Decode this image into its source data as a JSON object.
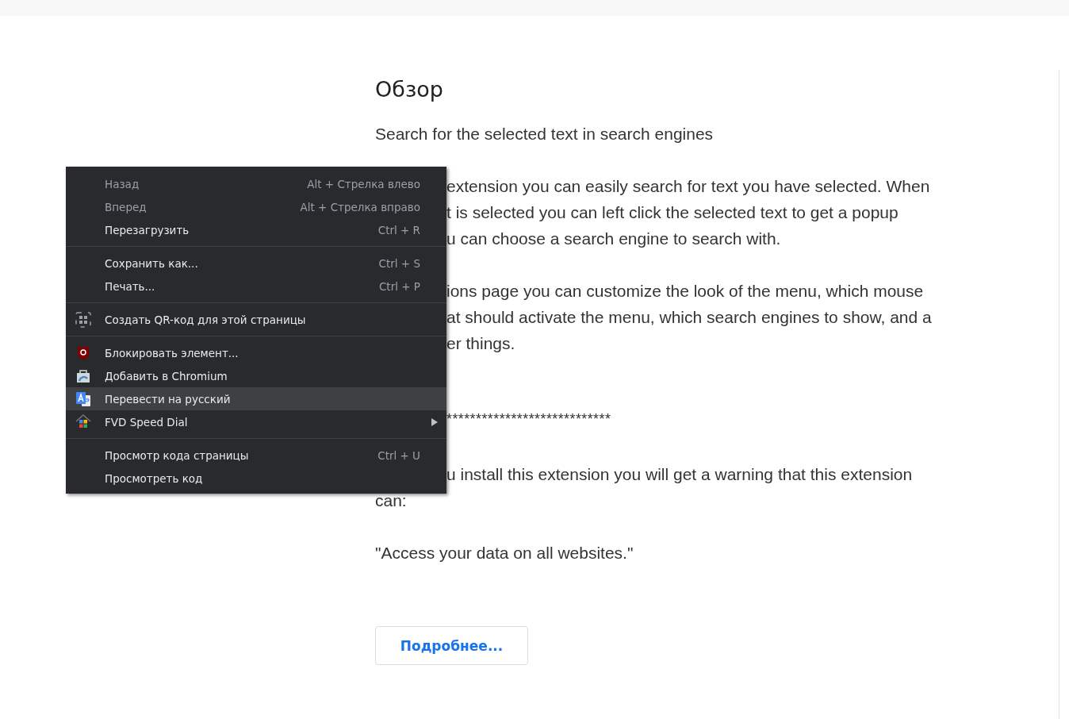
{
  "page": {
    "heading": "Обзор",
    "subtitle": "Search for the selected text in search engines",
    "paragraphs": [
      {
        "kind": "text",
        "lines": [
          {
            "text": "extension you can easily search for text you have selected. When",
            "clipped": true
          },
          {
            "text": "t is selected you can left click the selected text to get a popup",
            "clipped": true
          },
          {
            "text": "u can choose  a search engine to search with.",
            "clipped": true
          }
        ]
      },
      {
        "kind": "text",
        "lines": [
          {
            "text": "ions page you can customize the look of the menu, which mouse",
            "clipped": true
          },
          {
            "text": "at should activate the menu, which search engines to show, and a",
            "clipped": true
          },
          {
            "text": "er things.",
            "clipped": true
          }
        ]
      },
      {
        "kind": "divider",
        "lines": [
          {
            "text": "****************************",
            "clipped": true
          }
        ]
      },
      {
        "kind": "text",
        "lines": [
          {
            "text": "u install this extension you will get a warning that this extension",
            "clipped": true
          },
          {
            "text": "can:"
          }
        ]
      },
      {
        "kind": "text",
        "lines": [
          {
            "text": "\"Access your data on all websites.\""
          }
        ]
      }
    ],
    "more_button": "Подробнее..."
  },
  "context_menu": {
    "groups": [
      [
        {
          "kind": "plain",
          "label": "Назад",
          "shortcut": "Alt + Стрелка влево",
          "disabled": true,
          "selected": false
        },
        {
          "kind": "plain",
          "label": "Вперед",
          "shortcut": "Alt + Стрелка вправо",
          "disabled": true,
          "selected": false
        },
        {
          "kind": "plain",
          "label": "Перезагрузить",
          "shortcut": "Ctrl + R",
          "disabled": false,
          "selected": false
        }
      ],
      [
        {
          "kind": "plain",
          "label": "Сохранить как...",
          "shortcut": "Ctrl + S",
          "disabled": false,
          "selected": false
        },
        {
          "kind": "plain",
          "label": "Печать...",
          "shortcut": "Ctrl + P",
          "disabled": false,
          "selected": false
        }
      ],
      [
        {
          "kind": "icon",
          "label": "Создать QR-код для этой страницы",
          "disabled": false,
          "selected": false
        }
      ],
      [
        {
          "kind": "icon",
          "label": "Блокировать элемент...",
          "disabled": false,
          "selected": false
        },
        {
          "kind": "icon",
          "label": "Добавить в Chromium",
          "disabled": false,
          "selected": false
        },
        {
          "kind": "icon",
          "label": "Перевести на русский",
          "disabled": false,
          "selected": true
        },
        {
          "kind": "submenu",
          "label": "FVD Speed Dial",
          "disabled": false,
          "selected": false
        }
      ],
      [
        {
          "kind": "plain",
          "label": "Просмотр кода страницы",
          "shortcut": "Ctrl + U",
          "disabled": false,
          "selected": false
        },
        {
          "kind": "plain",
          "label": "Просмотреть код",
          "disabled": false,
          "selected": false
        }
      ]
    ]
  }
}
